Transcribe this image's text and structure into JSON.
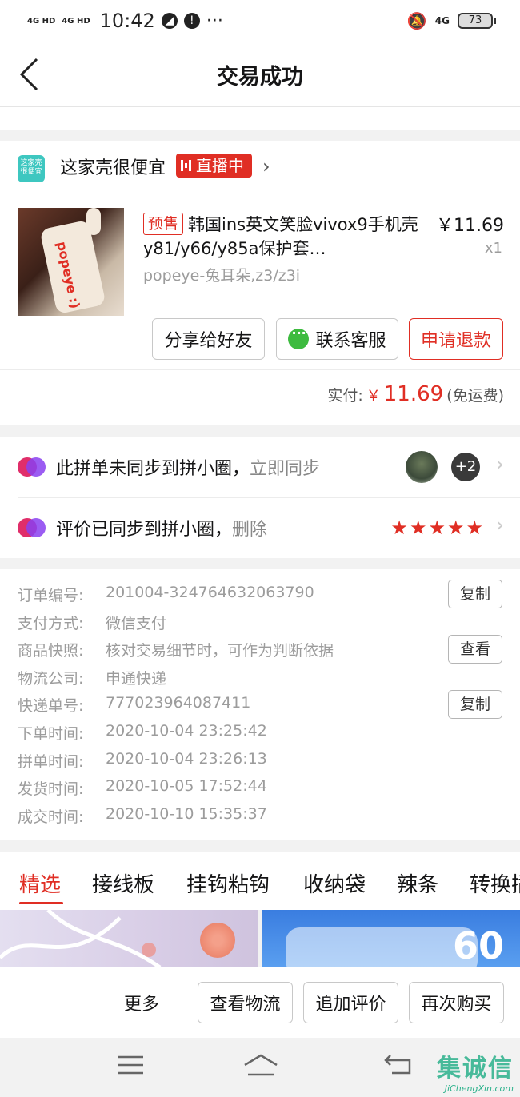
{
  "status_bar": {
    "net1": "4G HD",
    "net2": "4G HD",
    "time": "10:42",
    "right_net": "4G",
    "battery": "73"
  },
  "header": {
    "title": "交易成功"
  },
  "shop": {
    "name": "这家壳很便宜",
    "live_badge": "直播中",
    "logo_text": "这家壳很便宜"
  },
  "product": {
    "presale_tag": "预售",
    "title": "韩国ins英文笑脸vivox9手机壳y81/y66/y85a保护套…",
    "price": "￥11.69",
    "qty": "x1",
    "spec": "popeye-兔耳朵,z3/z3i",
    "image_text": "popeye :)"
  },
  "buttons": {
    "share": "分享给好友",
    "contact": "联系客服",
    "refund": "申请退款"
  },
  "paid": {
    "label": "实付:",
    "currency": "￥",
    "amount": "11.69",
    "note": "(免运费)"
  },
  "sync": {
    "row1_text": "此拼单未同步到拼小圈，",
    "row1_link": "立即同步",
    "row1_more": "+2",
    "row2_text": "评价已同步到拼小圈，",
    "row2_link": "删除",
    "rating_stars": 5
  },
  "order_info": [
    {
      "label": "订单编号:",
      "value": "201004-324764632063790",
      "action": "复制"
    },
    {
      "label": "支付方式:",
      "value": "微信支付",
      "action": ""
    },
    {
      "label": "商品快照:",
      "value": "核对交易细节时，可作为判断依据",
      "action": "查看"
    },
    {
      "label": "物流公司:",
      "value": "申通快递",
      "action": ""
    },
    {
      "label": "快递单号:",
      "value": "777023964087411",
      "action": "复制"
    },
    {
      "label": "下单时间:",
      "value": "2020-10-04 23:25:42",
      "action": ""
    },
    {
      "label": "拼单时间:",
      "value": "2020-10-04 23:26:13",
      "action": ""
    },
    {
      "label": "发货时间:",
      "value": "2020-10-05 17:52:44",
      "action": ""
    },
    {
      "label": "成交时间:",
      "value": "2020-10-10 15:35:37",
      "action": ""
    }
  ],
  "tabs": [
    "精选",
    "接线板",
    "挂钩粘钩",
    "收纳袋",
    "辣条",
    "转换插"
  ],
  "feed": {
    "item2_number": "60"
  },
  "bottom_actions": {
    "more": "更多",
    "logistics": "查看物流",
    "review": "追加评价",
    "rebuy": "再次购买"
  },
  "watermark": {
    "main": "集诚信",
    "sub": "JiChengXin.com"
  },
  "colors": {
    "accent": "#e02e24",
    "wechat": "#3dbb3f",
    "shop_logo": "#3ec7c0"
  }
}
